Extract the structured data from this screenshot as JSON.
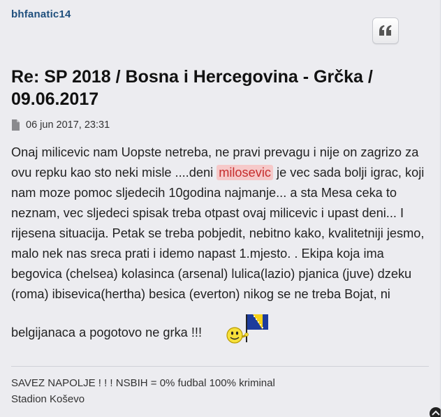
{
  "post": {
    "author": "bhfanatic14",
    "title": "Re: SP 2018 / Bosna i Hercegovina - Grčka / 09.06.2017",
    "timestamp": "06 jun 2017, 23:31",
    "body": {
      "line1_before": "Onaj milicevic nam Uopste netreba, ne pravi prevagu i nije on zagrizo za ovu repku kao sto neki misle ....deni ",
      "highlight": "milosevic",
      "line1_after": " je vec sada bolji igrac, koji nam moze pomoc sljedecih 10godina najmanje... a sta Mesa ceka to neznam, vec sljedeci spisak treba otpast ovaj milicevic i upast deni... I rijesena situacija. Petak se treba pobjedit, nebitno kako, kvalitetniji jesmo, malo nek nas sreca prati i idemo napast 1.mjesto. . Ekipa koja ima begovica (chelsea) kolasinca (arsenal) lulica(lazio) pjanica (juve) dzeku (roma) ibisevica(hertha) besica (everton) nikog se ne treba Bojat, ni",
      "last_line": "belgijanaca a pogotovo ne grka !!!",
      "emoticon": "smiley-with-bosnia-flag"
    },
    "signature": {
      "line1": "SAVEZ NAPOLJE ! ! ! NSBIH = 0% fudbal 100% kriminal",
      "line2": "Stadion Koševo"
    }
  },
  "colors": {
    "author": "#1f4f7d",
    "post_background": "#ececf0",
    "highlight_bg": "#f6c9c9",
    "highlight_text": "#c62c2c",
    "flag_blue": "#1d3c9c",
    "flag_yellow": "#f7d116"
  },
  "icons": {
    "quote": "quote-icon",
    "file": "file-icon",
    "corner": "chevron-up-icon"
  }
}
